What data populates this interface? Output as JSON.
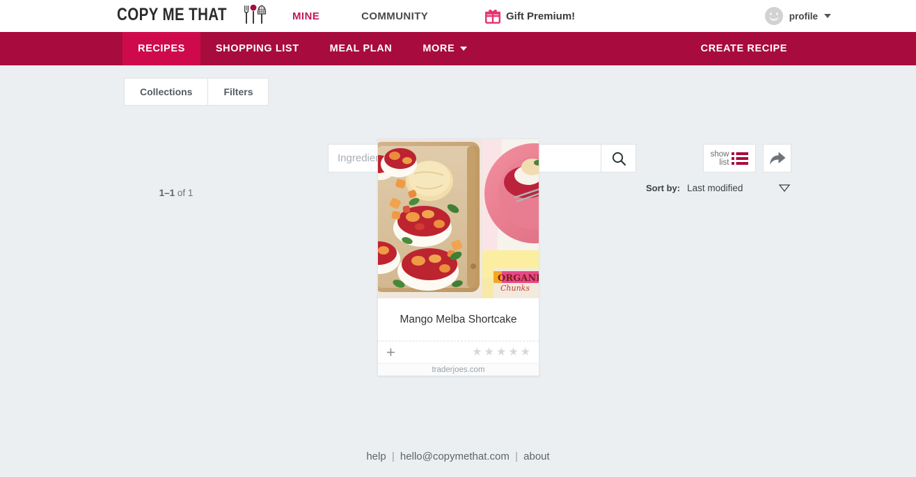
{
  "topbar": {
    "logo_text": "COPY ME THAT",
    "logo_icon": "utensils-icon",
    "nav": [
      {
        "label": "MINE",
        "name": "top-nav-mine",
        "accent": "#c2185b"
      },
      {
        "label": "COMMUNITY",
        "name": "top-nav-community",
        "accent": "#4a4a4a"
      }
    ],
    "gift": {
      "label": "Gift Premium!",
      "icon": "gift-icon",
      "icon_color": "#e5336f"
    },
    "profile": {
      "label": "profile",
      "avatar_icon": "smiley-avatar-icon",
      "caret_icon": "chevron-down-icon"
    }
  },
  "mainnav": {
    "background": "#a80b3d",
    "active_background": "#cf0a4c",
    "items": [
      {
        "label": "RECIPES",
        "active": true
      },
      {
        "label": "SHOPPING LIST",
        "active": false
      },
      {
        "label": "MEAL PLAN",
        "active": false
      },
      {
        "label": "MORE",
        "active": false,
        "has_caret": true
      }
    ],
    "create_label": "CREATE RECIPE"
  },
  "controls": {
    "collections_label": "Collections",
    "filters_label": "Filters",
    "search": {
      "placeholder": "Ingredients, dish, or text",
      "value": "",
      "button_icon": "search-icon"
    },
    "show_list": {
      "line1": "show",
      "line2": "list",
      "icon": "list-icon",
      "icon_color": "#a80b3d"
    },
    "share": {
      "icon": "share-arrow-icon"
    },
    "sort": {
      "label": "Sort by:",
      "value": "Last modified",
      "caret_icon": "triangle-down-icon"
    },
    "result_count_bold": "1–1",
    "result_count_rest": " of 1"
  },
  "recipes": [
    {
      "title": "Mango Melba Shortcake",
      "source": "traderjoes.com",
      "rating": 0,
      "max_rating": 5,
      "add_icon": "plus-icon",
      "photo_alt": "mango berry shortcakes on baking sheet"
    }
  ],
  "footer": {
    "help": "help",
    "email": "hello@copymethat.com",
    "about": "about",
    "separator": "|"
  },
  "colors": {
    "page_background": "#eceff1",
    "brand_crimson": "#a80b3d",
    "brand_pink": "#c2185b"
  }
}
